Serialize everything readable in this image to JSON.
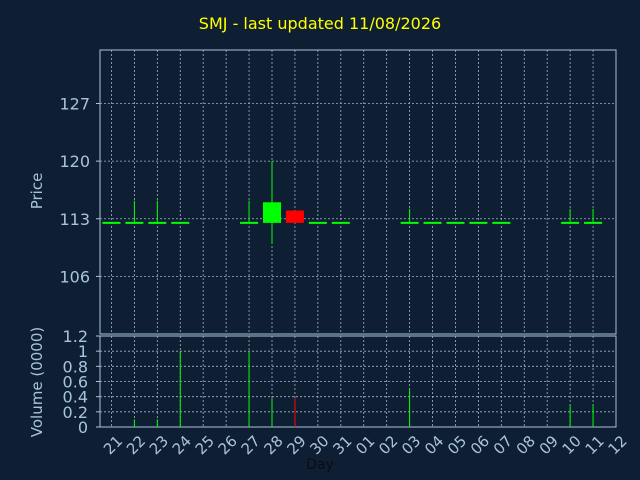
{
  "title": "SMJ - last updated 11/08/2026",
  "colors": {
    "background": "#0f1f33",
    "axis": "#a8c4dc",
    "grid": "#9fb3c8",
    "up": "#00ff00",
    "down": "#ff0000",
    "title": "#ffff00"
  },
  "chart_data": [
    {
      "type": "candlestick",
      "ylabel": "Price",
      "ylim": [
        99,
        133.5
      ],
      "yticks": [
        106,
        113,
        120,
        127
      ],
      "grid": true,
      "days": [
        "21",
        "22",
        "23",
        "24",
        "25",
        "26",
        "27",
        "28",
        "29",
        "30",
        "31",
        "01",
        "02",
        "03",
        "04",
        "05",
        "06",
        "07",
        "08",
        "09",
        "10",
        "11",
        "12"
      ],
      "candles": [
        {
          "day": "21",
          "open": 112.5,
          "high": 112.5,
          "low": 112.5,
          "close": 112.5
        },
        {
          "day": "22",
          "open": 112.5,
          "high": 115.2,
          "low": 112.5,
          "close": 112.5
        },
        {
          "day": "23",
          "open": 112.5,
          "high": 115.2,
          "low": 112.5,
          "close": 112.5
        },
        {
          "day": "24",
          "open": 112.5,
          "high": 112.5,
          "low": 112.5,
          "close": 112.5
        },
        {
          "day": "27",
          "open": 112.5,
          "high": 115.2,
          "low": 112.5,
          "close": 112.5
        },
        {
          "day": "28",
          "open": 112.5,
          "high": 120.0,
          "low": 110.0,
          "close": 115.0
        },
        {
          "day": "29",
          "open": 114.0,
          "high": 114.0,
          "low": 112.5,
          "close": 112.5
        },
        {
          "day": "30",
          "open": 112.5,
          "high": 112.5,
          "low": 112.5,
          "close": 112.5
        },
        {
          "day": "31",
          "open": 112.5,
          "high": 112.5,
          "low": 112.5,
          "close": 112.5
        },
        {
          "day": "03",
          "open": 112.5,
          "high": 114.2,
          "low": 112.5,
          "close": 112.5
        },
        {
          "day": "04",
          "open": 112.5,
          "high": 112.5,
          "low": 112.5,
          "close": 112.5
        },
        {
          "day": "05",
          "open": 112.5,
          "high": 112.5,
          "low": 112.5,
          "close": 112.5
        },
        {
          "day": "06",
          "open": 112.5,
          "high": 112.5,
          "low": 112.5,
          "close": 112.5
        },
        {
          "day": "07",
          "open": 112.5,
          "high": 112.5,
          "low": 112.5,
          "close": 112.5
        },
        {
          "day": "10",
          "open": 112.5,
          "high": 114.2,
          "low": 112.5,
          "close": 112.5
        },
        {
          "day": "11",
          "open": 112.5,
          "high": 114.2,
          "low": 112.5,
          "close": 112.5
        }
      ]
    },
    {
      "type": "bar",
      "ylabel": "Volume (0000)",
      "xlabel": "Day",
      "ylim": [
        0,
        1.2
      ],
      "yticks": [
        "0",
        "0.2",
        "0.4",
        "0.6",
        "0.8",
        "1",
        "1.2"
      ],
      "grid": true,
      "categories": [
        "21",
        "22",
        "23",
        "24",
        "25",
        "26",
        "27",
        "28",
        "29",
        "30",
        "31",
        "01",
        "02",
        "03",
        "04",
        "05",
        "06",
        "07",
        "08",
        "09",
        "10",
        "11",
        "12"
      ],
      "values": [
        0,
        0.1,
        0.1,
        1.0,
        0,
        0,
        1.0,
        0.38,
        0.38,
        0,
        0,
        0,
        0,
        0.5,
        0,
        0,
        0,
        0,
        0,
        0,
        0.3,
        0.3,
        0
      ],
      "colors": [
        "up",
        "up",
        "up",
        "up",
        "up",
        "up",
        "up",
        "up",
        "down",
        "up",
        "up",
        "up",
        "up",
        "up",
        "up",
        "up",
        "up",
        "up",
        "up",
        "up",
        "up",
        "up",
        "up"
      ]
    }
  ]
}
